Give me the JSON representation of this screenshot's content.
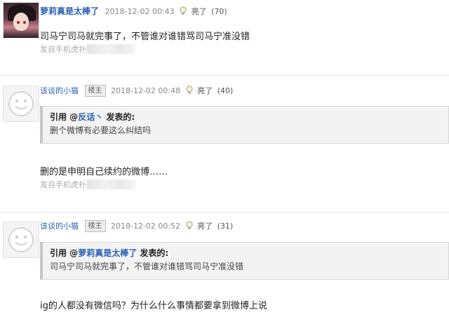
{
  "posts": [
    {
      "username": "萝莉真是太棒了",
      "date": "2018-12-02 00:43",
      "status": "亮了",
      "count": "(70)",
      "content": "司马宁司马就完事了，不管谁对谁错骂司马宁准没错",
      "source": "发自手机虎扑"
    },
    {
      "username": "该谈的小猫",
      "badge": "楼主",
      "date": "2018-12-02 00:48",
      "status": "亮了",
      "count": "(40)",
      "quote": {
        "prefix": "引用 @",
        "user": "反话丶",
        "suffix": "发表的:",
        "text": "删个微博有必要这么纠结吗"
      },
      "content": "删的是申明自己续约的微博……",
      "source": "发自手机虎扑"
    },
    {
      "username": "该谈的小猫",
      "badge": "楼主",
      "date": "2018-12-02 00:52",
      "status": "亮了",
      "count": "(31)",
      "quote": {
        "prefix": "引用 @",
        "user": "萝莉真是太棒了",
        "suffix": "发表的:",
        "text": "司马宁司马就完事了，不管谁对谁错骂司马宁准没错"
      },
      "content": "ig的人都没有微信吗？为什么什么事情都要拿到微博上说"
    }
  ]
}
